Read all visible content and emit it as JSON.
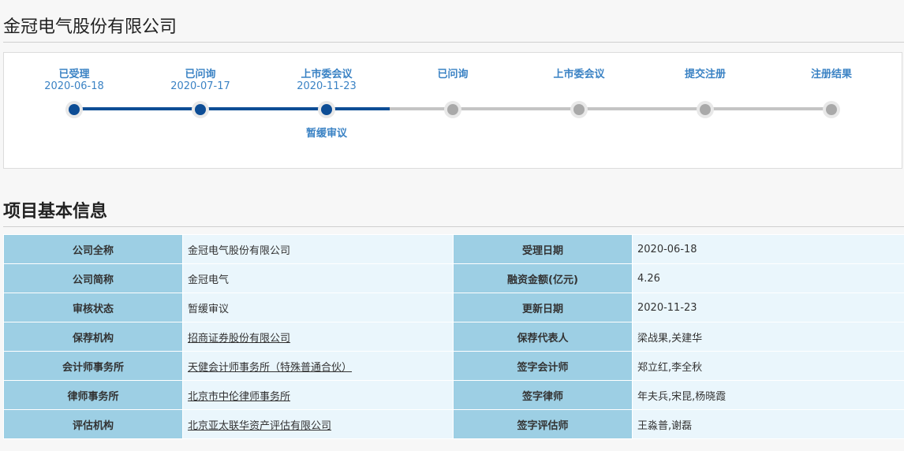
{
  "header": {
    "title": "金冠电气股份有限公司"
  },
  "progress": {
    "steps": [
      {
        "label": "已受理",
        "date": "2020-06-18",
        "state": "done"
      },
      {
        "label": "已问询",
        "date": "2020-07-17",
        "state": "done"
      },
      {
        "label": "上市委会议",
        "date": "2020-11-23",
        "state": "done",
        "sub_status": "暂缓审议"
      },
      {
        "label": "已问询",
        "date": "",
        "state": "todo"
      },
      {
        "label": "上市委会议",
        "date": "",
        "state": "todo"
      },
      {
        "label": "提交注册",
        "date": "",
        "state": "todo"
      },
      {
        "label": "注册结果",
        "date": "",
        "state": "todo"
      }
    ]
  },
  "info": {
    "title": "项目基本信息",
    "rows": [
      {
        "k1": "公司全称",
        "v1": "金冠电气股份有限公司",
        "v1_link": false,
        "k2": "受理日期",
        "v2": "2020-06-18"
      },
      {
        "k1": "公司简称",
        "v1": "金冠电气",
        "v1_link": false,
        "k2": "融资金额(亿元)",
        "v2": "4.26"
      },
      {
        "k1": "审核状态",
        "v1": "暂缓审议",
        "v1_link": false,
        "k2": "更新日期",
        "v2": "2020-11-23"
      },
      {
        "k1": "保荐机构",
        "v1": "招商证券股份有限公司",
        "v1_link": true,
        "k2": "保荐代表人",
        "v2": "梁战果,关建华"
      },
      {
        "k1": "会计师事务所",
        "v1": "天健会计师事务所（特殊普通合伙）",
        "v1_link": true,
        "k2": "签字会计师",
        "v2": "郑立红,李全秋"
      },
      {
        "k1": "律师事务所",
        "v1": "北京市中伦律师事务所",
        "v1_link": true,
        "k2": "签字律师",
        "v2": "年夫兵,宋昆,杨晓霞"
      },
      {
        "k1": "评估机构",
        "v1": "北京亚太联华资产评估有限公司",
        "v1_link": true,
        "k2": "签字评估师",
        "v2": "王淼普,谢磊"
      }
    ]
  }
}
